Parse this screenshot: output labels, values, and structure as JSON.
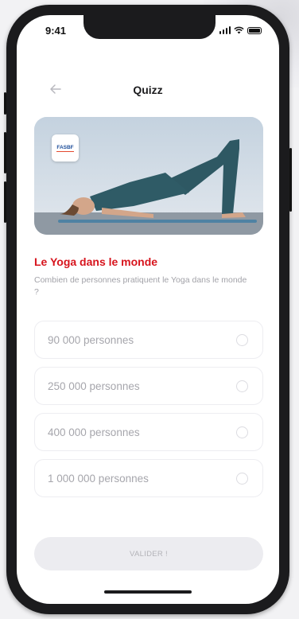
{
  "status_bar": {
    "time": "9:41"
  },
  "header": {
    "back_icon": "arrow-left-icon",
    "title": "Quizz"
  },
  "hero": {
    "logo_text": "FASBF"
  },
  "question": {
    "title": "Le Yoga dans le monde",
    "text": "Combien de personnes pratiquent le Yoga dans le monde ?"
  },
  "options": [
    {
      "label": "90 000 personnes",
      "selected": false
    },
    {
      "label": "250 000 personnes",
      "selected": false
    },
    {
      "label": "400 000 personnes",
      "selected": false
    },
    {
      "label": "1 000 000 personnes",
      "selected": false
    }
  ],
  "submit": {
    "label": "VALIDER !"
  },
  "colors": {
    "accent": "#d7141d",
    "muted_text": "#a6a6ac",
    "button_bg": "#ececf0"
  }
}
